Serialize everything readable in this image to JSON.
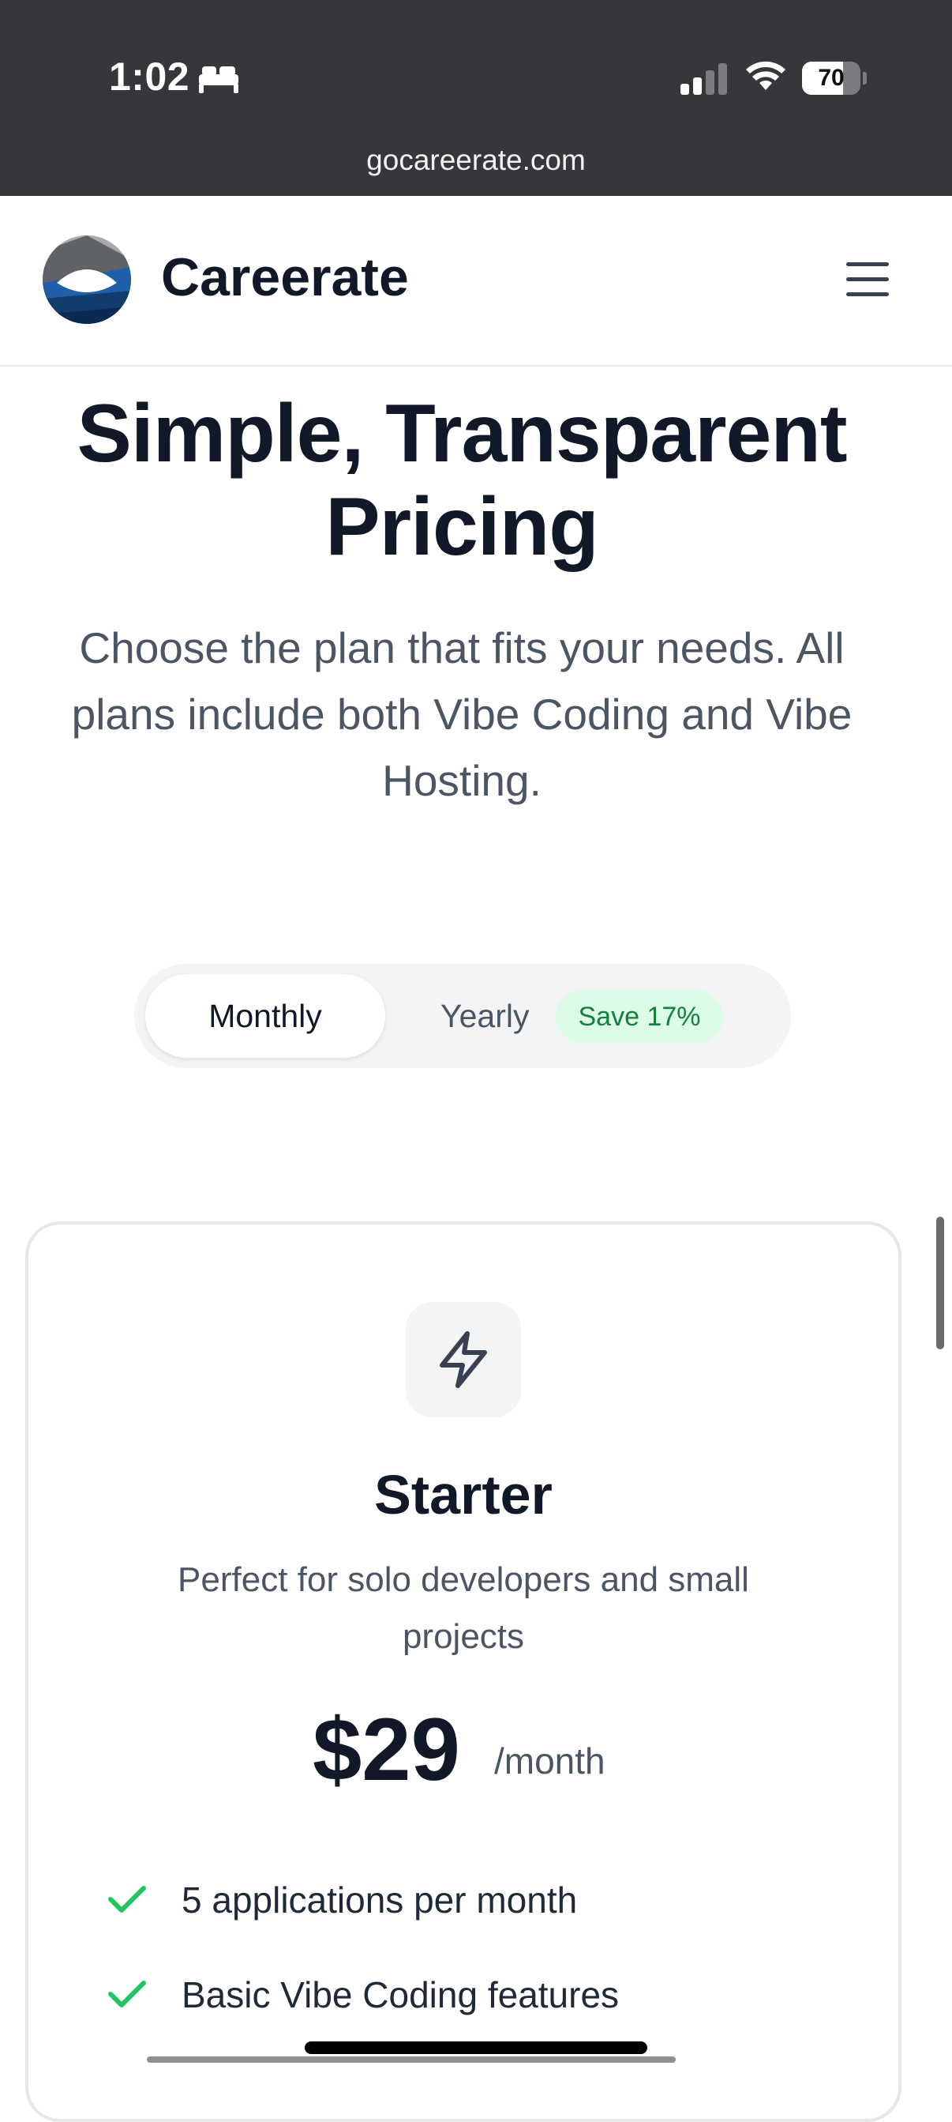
{
  "status_bar": {
    "time": "1:02",
    "battery": "70",
    "battery_level": 0.7,
    "url": "gocareerate.com",
    "icons": [
      "bed-icon",
      "cellular-signal-icon",
      "wifi-icon",
      "battery-icon"
    ]
  },
  "header": {
    "brand": "Careerate",
    "logo_icon": "careerate-logo",
    "menu_icon": "hamburger-menu-icon"
  },
  "hero": {
    "title": "Simple, Transparent Pricing",
    "subtitle": "Choose the plan that fits your needs. All plans include both Vibe Coding and Vibe Hosting."
  },
  "billing_toggle": {
    "monthly": "Monthly",
    "yearly": "Yearly",
    "badge": "Save 17%",
    "selected": "Monthly"
  },
  "plan": {
    "icon": "lightning-bolt-icon",
    "name": "Starter",
    "description": "Perfect for solo developers and small projects",
    "price": "$29",
    "period": "/month",
    "features": [
      "5 applications per month",
      "Basic Vibe Coding features"
    ]
  },
  "colors": {
    "status_bar_bg": "#35373a",
    "text_dark": "#111827",
    "text_muted": "#4b5563",
    "badge_bg": "#dcfce7",
    "badge_text": "#15803d",
    "check_green": "#22c55e",
    "logo_blue": "#1e5fa8"
  }
}
